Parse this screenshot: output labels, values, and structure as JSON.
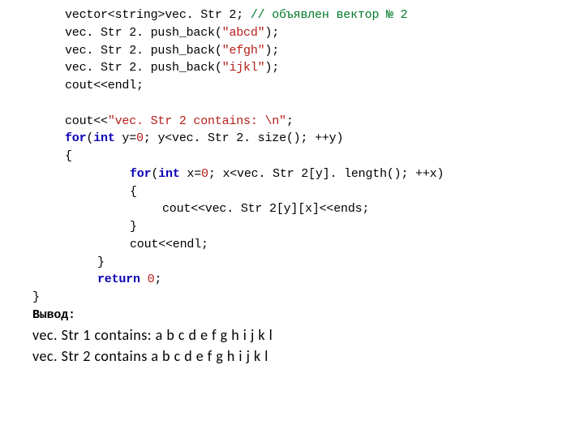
{
  "code": {
    "l1_a": "vector<string>vec. Str 2;",
    "l1_c": " // объявлен вектор № 2",
    "l2_a": "vec. Str 2. push_back(",
    "l2_b": "\"abcd\"",
    "l2_c": ");",
    "l3_a": "vec. Str 2. push_back(",
    "l3_b": "\"efgh\"",
    "l3_c": ");",
    "l4_a": "vec. Str 2. push_back(",
    "l4_b": "\"ijkl\"",
    "l4_c": ");",
    "l5": "cout<<endl;",
    "l6_a": "cout<<",
    "l6_b": "\"vec. Str 2 contains: \\n\"",
    "l6_c": ";",
    "l7_a": "for",
    "l7_b": "(",
    "l7_c": "int",
    "l7_d": " y=",
    "l7_e": "0",
    "l7_f": "; y<vec. Str 2. size(); ++y)",
    "l8": "{",
    "l9_a": "for",
    "l9_b": "(",
    "l9_c": "int",
    "l9_d": " x=",
    "l9_e": "0",
    "l9_f": "; x<vec. Str 2[y]. length(); ++x)",
    "l10": "{",
    "l11": "cout<<vec. Str 2[y][x]<<ends;",
    "l12": "}",
    "l13": "cout<<endl;",
    "l14": "}",
    "l15_a": "return",
    "l15_b": " ",
    "l15_c": "0",
    "l15_d": ";",
    "l16": "}"
  },
  "output": {
    "label": "Вывод:",
    "line1": "vec. Str 1 contains: a b c d e f g h i j k l",
    "line2": "vec. Str 2 contains a b c d e f g h i j k l"
  }
}
